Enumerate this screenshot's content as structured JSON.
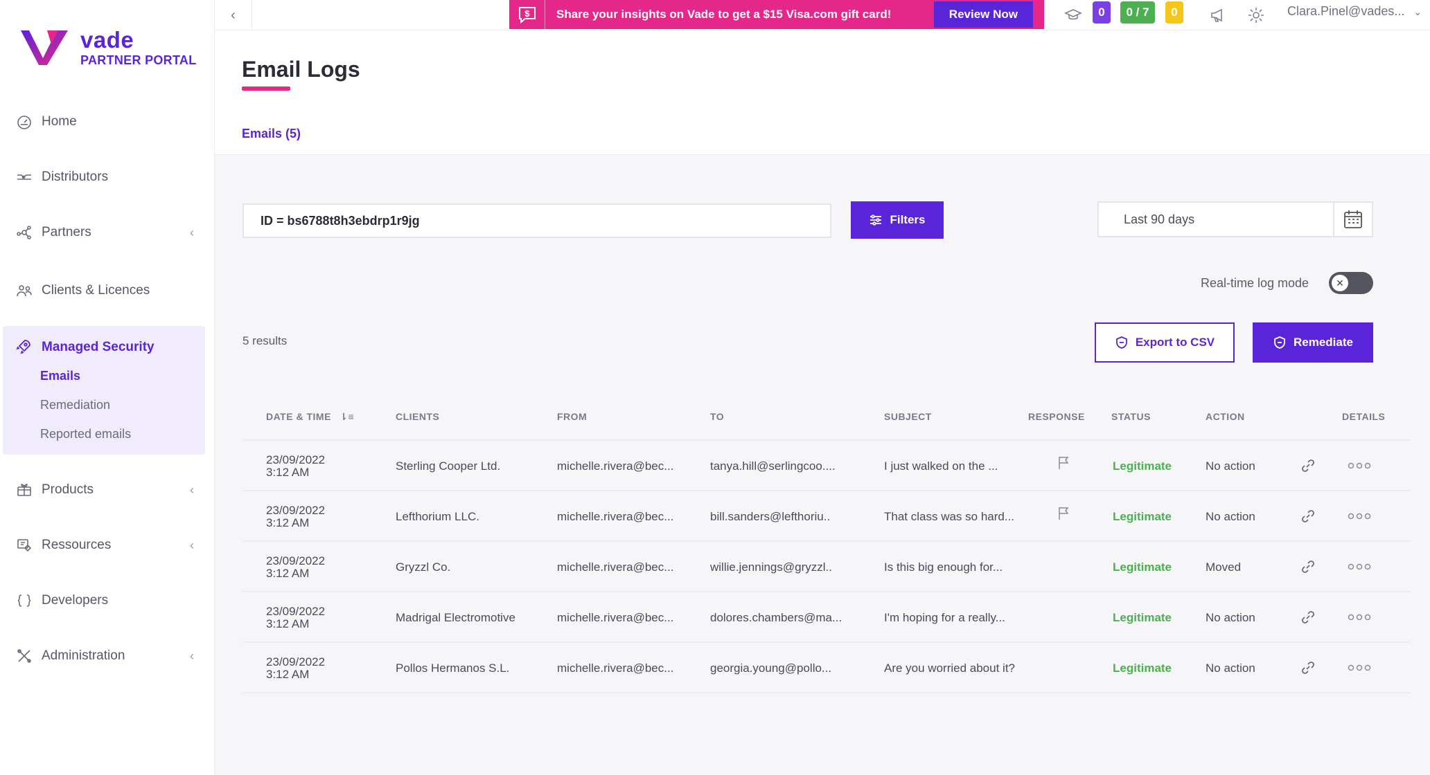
{
  "brand": {
    "name": "vade",
    "subtitle": "PARTNER PORTAL",
    "primary_color": "#5a24d9",
    "accent_color": "#e5278a"
  },
  "sidebar": {
    "items": [
      {
        "label": "Home",
        "icon": "dashboard-icon"
      },
      {
        "label": "Distributors",
        "icon": "distributors-icon"
      },
      {
        "label": "Partners",
        "icon": "partners-icon"
      },
      {
        "label": "Clients & Licences",
        "icon": "clients-icon"
      },
      {
        "label": "Products",
        "icon": "products-icon"
      },
      {
        "label": "Ressources",
        "icon": "resources-icon"
      },
      {
        "label": "Developers",
        "icon": "code-icon"
      },
      {
        "label": "Administration",
        "icon": "admin-icon"
      }
    ],
    "managed_security": {
      "label": "Managed Security",
      "sub_items": [
        "Emails",
        "Remediation",
        "Reported emails"
      ]
    }
  },
  "topbar": {
    "promo_text": "Share your insights on Vade to get a $15 Visa.com gift card!",
    "promo_button": "Review Now",
    "badges": [
      {
        "value": "0",
        "color": "#7b3fe4"
      },
      {
        "value": "0 / 7",
        "color": "#4caf50"
      },
      {
        "value": "0",
        "color": "#f5c518"
      }
    ],
    "user": "Clara.Pinel@vades..."
  },
  "header": {
    "title": "Email Logs",
    "tab_label": "Emails (5)"
  },
  "toolbar": {
    "search_value": "ID = bs6788t8h3ebdrp1r9jg",
    "filters_label": "Filters",
    "date_range": "Last 90 days",
    "realtime_label": "Real-time log mode",
    "realtime_enabled": false,
    "results_label": "5 results",
    "export_label": "Export to CSV",
    "remediate_label": "Remediate"
  },
  "table": {
    "columns": [
      "DATE & TIME",
      "CLIENTS",
      "FROM",
      "TO",
      "SUBJECT",
      "RESPONSE",
      "STATUS",
      "ACTION",
      "DETAILS"
    ],
    "rows": [
      {
        "date": "23/09/2022",
        "time": "3:12 AM",
        "client": "Sterling Cooper Ltd.",
        "from": "michelle.rivera@bec...",
        "to": "tanya.hill@serlingcoo....",
        "subject": "I just walked on the ...",
        "response_flag": true,
        "status": "Legitimate",
        "action": "No action"
      },
      {
        "date": "23/09/2022",
        "time": "3:12 AM",
        "client": "Lefthorium LLC.",
        "from": "michelle.rivera@bec...",
        "to": "bill.sanders@lefthoriu..",
        "subject": "That class was so hard...",
        "response_flag": true,
        "status": "Legitimate",
        "action": "No action"
      },
      {
        "date": "23/09/2022",
        "time": "3:12 AM",
        "client": "Gryzzl Co.",
        "from": "michelle.rivera@bec...",
        "to": "willie.jennings@gryzzl..",
        "subject": "Is this big enough for...",
        "response_flag": false,
        "status": "Legitimate",
        "action": "Moved"
      },
      {
        "date": "23/09/2022",
        "time": "3:12 AM",
        "client": "Madrigal Electromotive",
        "from": "michelle.rivera@bec...",
        "to": "dolores.chambers@ma...",
        "subject": "I'm hoping for a really...",
        "response_flag": false,
        "status": "Legitimate",
        "action": "No action"
      },
      {
        "date": "23/09/2022",
        "time": "3:12 AM",
        "client": "Pollos Hermanos S.L.",
        "from": "michelle.rivera@bec...",
        "to": "georgia.young@pollo...",
        "subject": "Are you worried about it?",
        "response_flag": false,
        "status": "Legitimate",
        "action": "No action"
      }
    ]
  }
}
